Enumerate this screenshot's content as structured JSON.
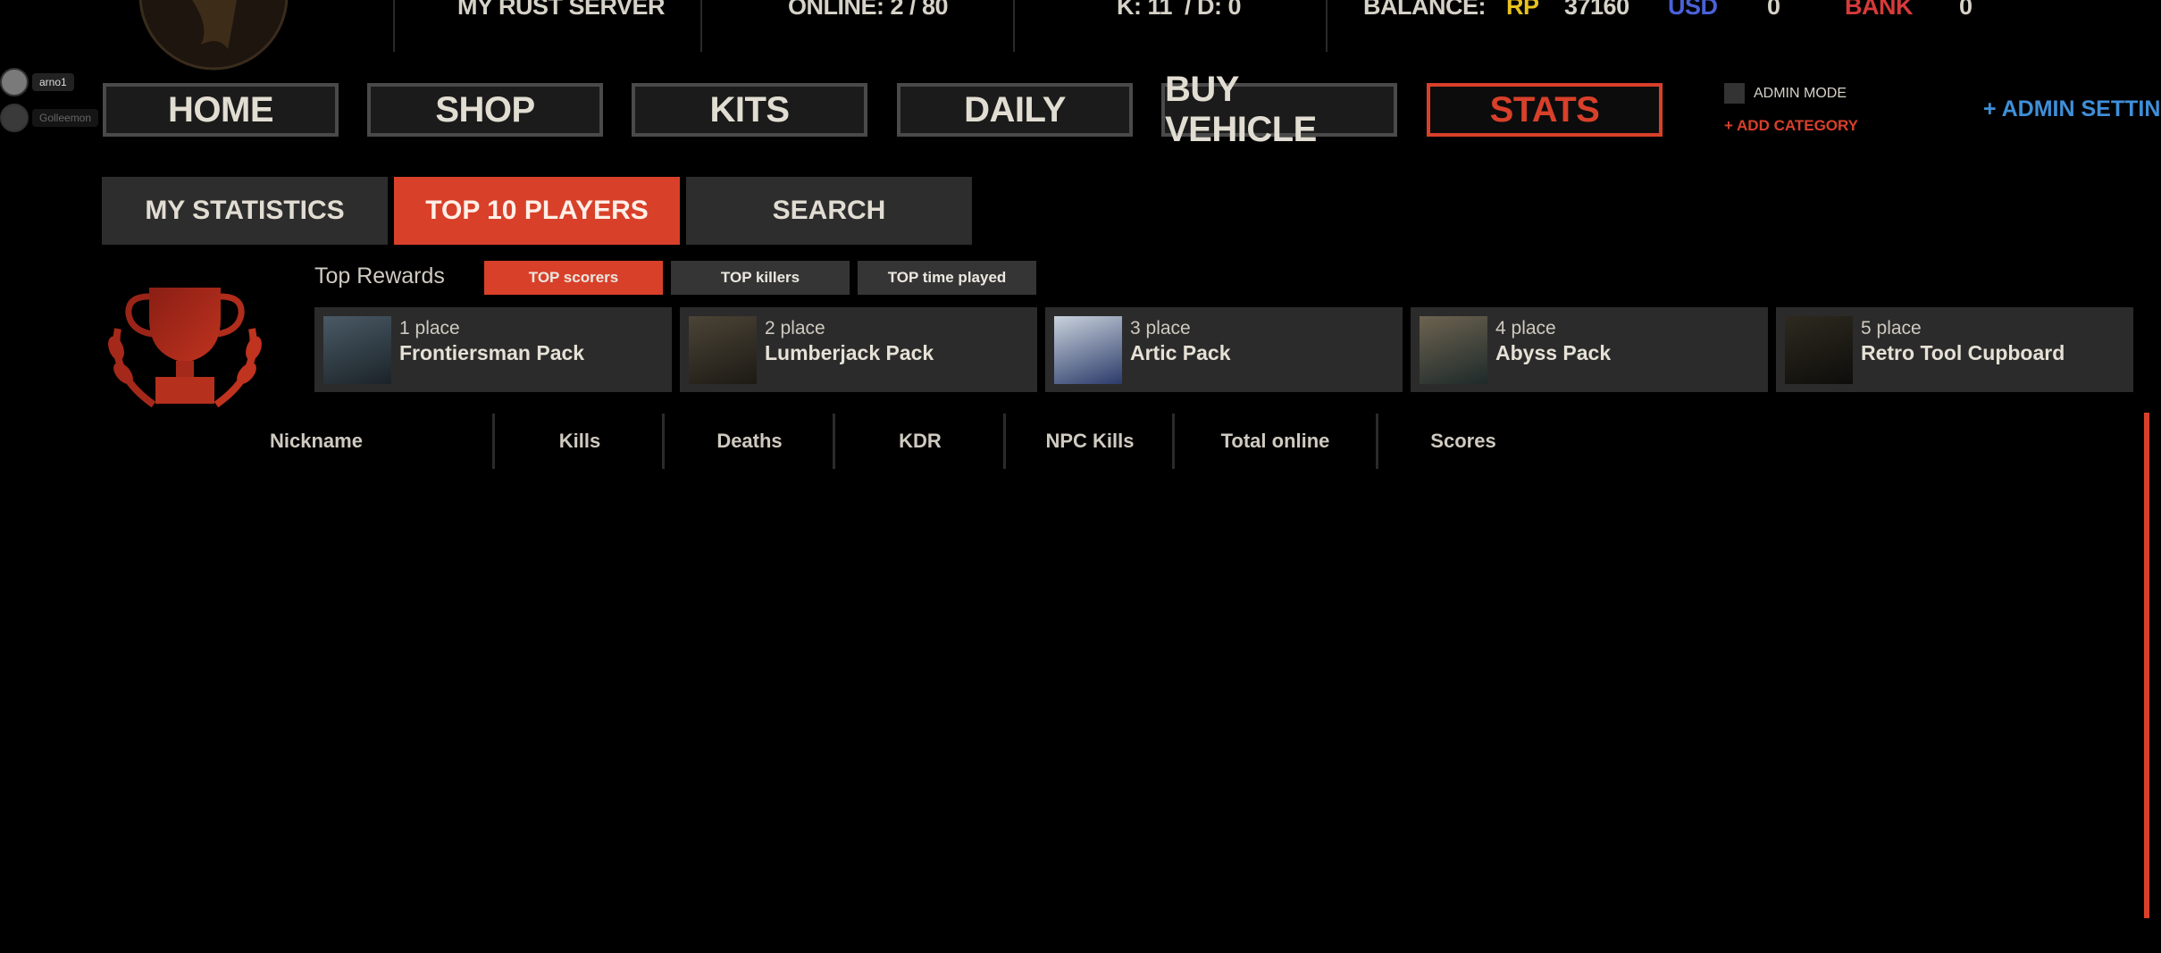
{
  "header": {
    "server_name": "MY RUST SERVER",
    "online": "ONLINE: 2 / 80",
    "kd": "K: 11  / D: 0",
    "balance_label": "BALANCE:",
    "rp_label": "RP",
    "rp_value": "37160",
    "usd_label": "USD",
    "usd_value": "0",
    "bank_label": "BANK",
    "bank_value": "0"
  },
  "players": [
    {
      "name": "arno1"
    },
    {
      "name": "Golleemon"
    }
  ],
  "nav": [
    {
      "label": "HOME"
    },
    {
      "label": "SHOP"
    },
    {
      "label": "KITS"
    },
    {
      "label": "DAILY"
    },
    {
      "label": "BUY VEHICLE"
    },
    {
      "label": "STATS",
      "active": true
    }
  ],
  "admin": {
    "mode_label": "ADMIN MODE",
    "add_category": "+ ADD CATEGORY",
    "settings": "+ ADMIN SETTINGS"
  },
  "subtabs": [
    {
      "label": "MY STATISTICS"
    },
    {
      "label": "TOP 10 PLAYERS",
      "active": true
    },
    {
      "label": "SEARCH"
    }
  ],
  "rewards": {
    "title": "Top Rewards",
    "filters": [
      {
        "label": "TOP scorers",
        "active": true
      },
      {
        "label": "TOP killers"
      },
      {
        "label": "TOP time played"
      }
    ],
    "items": [
      {
        "place": "1 place",
        "name": "Frontiersman Pack"
      },
      {
        "place": "2 place",
        "name": "Lumberjack Pack"
      },
      {
        "place": "3 place",
        "name": "Artic Pack"
      },
      {
        "place": "4 place",
        "name": "Abyss Pack"
      },
      {
        "place": "5 place",
        "name": "Retro Tool Cupboard"
      }
    ]
  },
  "table": {
    "columns": [
      "Nickname",
      "Kills",
      "Deaths",
      "KDR",
      "NPC Kills",
      "Total online",
      "Scores"
    ]
  },
  "colors": {
    "accent": "#d8402a",
    "rp": "#e8c21e",
    "usd": "#4a62d8",
    "bank": "#d83a3a",
    "admin_settings": "#3f8fd8"
  }
}
